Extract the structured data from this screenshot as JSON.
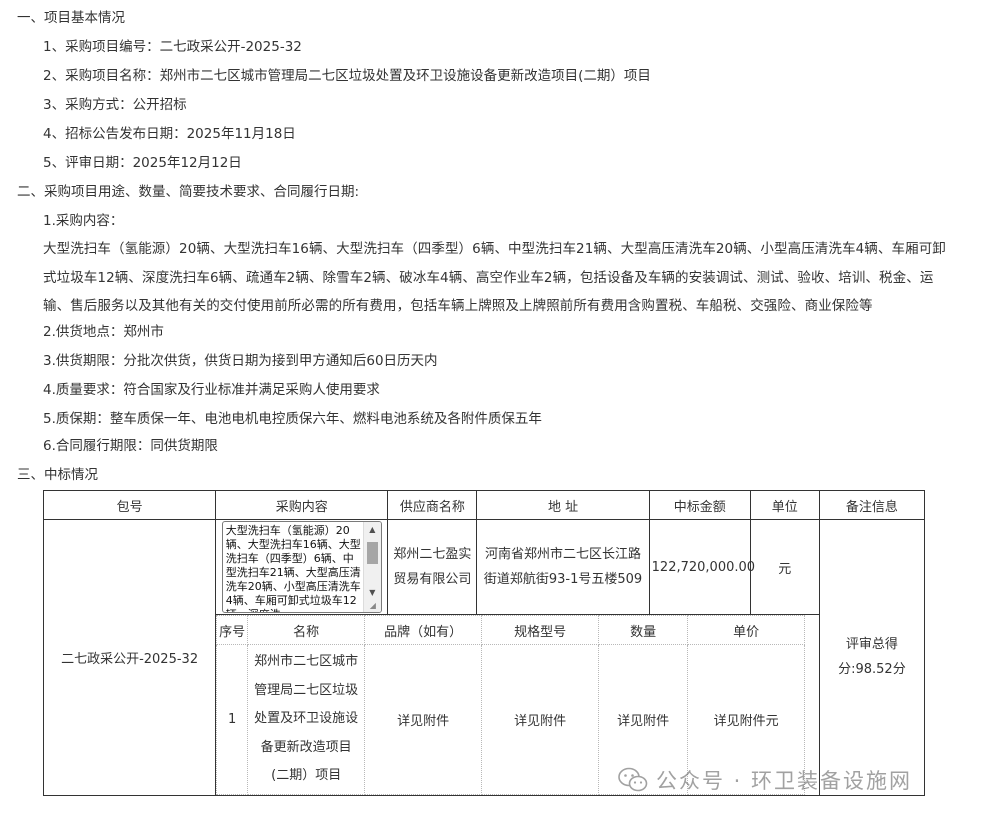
{
  "section1": {
    "heading": "一、项目基本情况",
    "items": [
      "1、采购项目编号：二七政采公开-2025-32",
      "2、采购项目名称：郑州市二七区城市管理局二七区垃圾处置及环卫设施设备更新改造项目(二期）项目",
      "3、采购方式：公开招标",
      "4、招标公告发布日期：2025年11月18日",
      "5、评审日期：2025年12月12日"
    ]
  },
  "section2": {
    "heading": "二、采购项目用途、数量、简要技术要求、合同履行日期:",
    "content_heading": "1.采购内容：",
    "content_lines": [
      "大型洗扫车（氢能源）20辆、大型洗扫车16辆、大型洗扫车（四季型）6辆、中型洗扫车21辆、大型高压清洗车20辆、小型高压清洗车4辆、车厢可卸",
      "式垃圾车12辆、深度洗扫车6辆、疏通车2辆、除雪车2辆、破冰车4辆、高空作业车2辆，包括设备及车辆的安装调试、测试、验收、培训、税金、运",
      "输、售后服务以及其他有关的交付使用前所必需的所有费用，包括车辆上牌照及上牌照前所有费用含购置税、车船税、交强险、商业保险等"
    ],
    "items": [
      "2.供货地点：郑州市",
      "3.供货期限：分批次供货，供货日期为接到甲方通知后60日历天内",
      "4.质量要求：符合国家及行业标准并满足采购人使用要求",
      "5.质保期：整车质保一年、电池电机电控质保六年、燃料电池系统及各附件质保五年",
      "6.合同履行期限：同供货期限"
    ]
  },
  "section3": {
    "heading": "三、中标情况"
  },
  "award_table": {
    "headers": {
      "package": "包号",
      "content": "采购内容",
      "supplier": "供应商名称",
      "address": "地 址",
      "amount": "中标金额",
      "unit": "单位",
      "remarks": "备注信息"
    },
    "package_no": "二七政采公开-2025-32",
    "content_text": "大型洗扫车（氢能源）20辆、大型洗扫车16辆、大型洗扫车（四季型）6辆、中型洗扫车21辆、大型高压清洗车20辆、小型高压清洗车4辆、车厢可卸式垃圾车12辆、深度洗",
    "supplier_lines": [
      "郑州二七盈实",
      "贸易有限公司"
    ],
    "address_lines": [
      "河南省郑州市二七区长江路",
      "街道郑航街93-1号五楼509"
    ],
    "amount": "122,720,000.00",
    "unit": "元",
    "remarks_lines": [
      "评审总得",
      "分:98.52分"
    ]
  },
  "detail_table": {
    "headers": {
      "seq": "序号",
      "name": "名称",
      "brand": "品牌（如有）",
      "model": "规格型号",
      "qty": "数量",
      "price": "单价"
    },
    "rows": [
      {
        "seq": "1",
        "name_lines": [
          "郑州市二七区城市",
          "管理局二七区垃圾",
          "处置及环卫设施设",
          "备更新改造项目",
          "(二期）项目"
        ],
        "brand": "详见附件",
        "model": "详见附件",
        "qty": "详见附件",
        "price": "详见附件元"
      }
    ]
  },
  "watermark": {
    "text": "公众号 · 环卫装备设施网",
    "icon": "wechat-icon"
  }
}
